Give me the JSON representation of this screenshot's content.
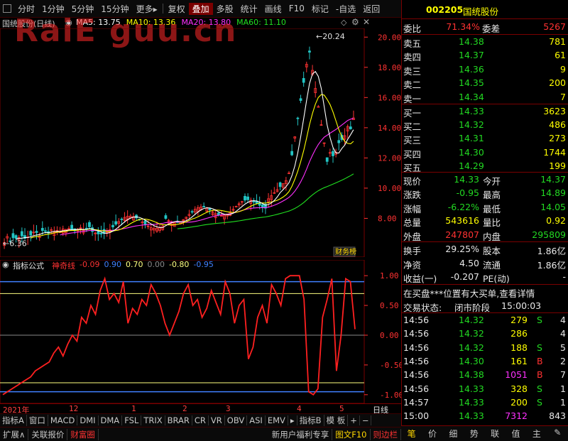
{
  "toolbar": {
    "items": [
      "分时",
      "1分钟",
      "5分钟",
      "15分钟",
      "更多",
      "复权",
      "叠加",
      "多股",
      "统计",
      "画线",
      "F10",
      "标记",
      "-自选",
      "返回"
    ],
    "more_arrow": "▸"
  },
  "watermark": "RaiE guu.cn",
  "main_chart": {
    "title": "国统股份(日线)",
    "ma_legend": [
      {
        "label": "MA5: 13.75",
        "color": "#ffffff"
      },
      {
        "label": "MA10: 13.36",
        "color": "#ffff00"
      },
      {
        "label": "MA20: 13.80",
        "color": "#ff30ff"
      },
      {
        "label": "MA60: 11.10",
        "color": "#20e020"
      }
    ],
    "price_ticks": [
      "20.00",
      "18.00",
      "16.00",
      "14.00",
      "12.00",
      "10.00",
      "8.00"
    ],
    "high_label": "20.24",
    "low_label": "6.36",
    "badge": "财务",
    "badge2": "榜"
  },
  "indicator": {
    "title": "指标公式",
    "name": "神奇线",
    "values": [
      {
        "label": "-0.09",
        "color": "#ff3232"
      },
      {
        "label": "0.90",
        "color": "#4080ff"
      },
      {
        "label": "0.70",
        "color": "#ffff80"
      },
      {
        "label": "0.00",
        "color": "#888888"
      },
      {
        "label": "-0.80",
        "color": "#ffff80"
      },
      {
        "label": "-0.95",
        "color": "#4080ff"
      }
    ],
    "ticks": [
      "1.00",
      "0.50",
      "0.00",
      "-0.50",
      "-1.00"
    ]
  },
  "time_axis": {
    "labels": [
      "2021年",
      "12",
      "1",
      "2",
      "3",
      "4",
      "5"
    ],
    "period": "日线"
  },
  "bottom_tabs": [
    "指标A",
    "窗口",
    "MACD",
    "DMI",
    "DMA",
    "FSL",
    "TRIX",
    "BRAR",
    "CR",
    "VR",
    "OBV",
    "ASI",
    "EMV",
    "▸",
    "指标B",
    "模 板",
    "+",
    "−"
  ],
  "status_bar": [
    "扩展∧",
    "关联报价",
    "财富圈",
    "新用户福利专享",
    "图文F10",
    "则边栏"
  ],
  "quote": {
    "code": "002205",
    "name": "国统股份",
    "weibi_label": "委比",
    "weibi": "71.34%",
    "weicha_label": "委差",
    "weicha": "5267",
    "asks": [
      {
        "label": "卖五",
        "price": "14.38",
        "vol": "781"
      },
      {
        "label": "卖四",
        "price": "14.37",
        "vol": "61"
      },
      {
        "label": "卖三",
        "price": "14.36",
        "vol": "9"
      },
      {
        "label": "卖二",
        "price": "14.35",
        "vol": "200"
      },
      {
        "label": "卖一",
        "price": "14.34",
        "vol": "7"
      }
    ],
    "bids": [
      {
        "label": "买一",
        "price": "14.33",
        "vol": "3623"
      },
      {
        "label": "买二",
        "price": "14.32",
        "vol": "486"
      },
      {
        "label": "买三",
        "price": "14.31",
        "vol": "273"
      },
      {
        "label": "买四",
        "price": "14.30",
        "vol": "1744"
      },
      {
        "label": "买五",
        "price": "14.29",
        "vol": "199"
      }
    ],
    "stats": [
      {
        "l1": "现价",
        "v1": "14.33",
        "c1": "green",
        "l2": "今开",
        "v2": "14.37",
        "c2": "green"
      },
      {
        "l1": "涨跌",
        "v1": "-0.95",
        "c1": "green",
        "l2": "最高",
        "v2": "14.89",
        "c2": "green"
      },
      {
        "l1": "涨幅",
        "v1": "-6.22%",
        "c1": "green",
        "l2": "最低",
        "v2": "14.05",
        "c2": "green"
      },
      {
        "l1": "总量",
        "v1": "543616",
        "c1": "yellow",
        "l2": "量比",
        "v2": "0.92",
        "c2": "yellow"
      },
      {
        "l1": "外盘",
        "v1": "247807",
        "c1": "red",
        "l2": "内盘",
        "v2": "295809",
        "c2": "green"
      }
    ],
    "stats2": [
      {
        "l1": "换手",
        "v1": "29.25%",
        "l2": "股本",
        "v2": "1.86亿"
      },
      {
        "l1": "净资",
        "v1": "4.50",
        "l2": "流通",
        "v2": "1.86亿"
      },
      {
        "l1": "收益(一)",
        "v1": "-0.207",
        "l2": "PE(动)",
        "v2": "-"
      }
    ],
    "notice": "在买盘***位置有大买单,查看详情",
    "trade_status_label": "交易状态:",
    "trade_status": "闭市阶段",
    "trade_time": "15:00:03",
    "ticks": [
      {
        "t": "14:56",
        "p": "14.32",
        "v": "279",
        "d": "S",
        "n": "4",
        "vc": "yellow",
        "dc": "green"
      },
      {
        "t": "14:56",
        "p": "14.32",
        "v": "286",
        "d": "",
        "n": "4",
        "vc": "yellow",
        "dc": "green"
      },
      {
        "t": "14:56",
        "p": "14.32",
        "v": "188",
        "d": "S",
        "n": "5",
        "vc": "yellow",
        "dc": "green"
      },
      {
        "t": "14:56",
        "p": "14.30",
        "v": "161",
        "d": "B",
        "n": "2",
        "vc": "yellow",
        "dc": "red"
      },
      {
        "t": "14:56",
        "p": "14.38",
        "v": "1051",
        "d": "B",
        "n": "7",
        "vc": "magenta",
        "dc": "red"
      },
      {
        "t": "14:56",
        "p": "14.33",
        "v": "328",
        "d": "S",
        "n": "1",
        "vc": "yellow",
        "dc": "green"
      },
      {
        "t": "14:57",
        "p": "14.33",
        "v": "200",
        "d": "S",
        "n": "1",
        "vc": "yellow",
        "dc": "green"
      },
      {
        "t": "15:00",
        "p": "14.33",
        "v": "7312",
        "d": "",
        "n": "843",
        "vc": "magenta",
        "dc": "green"
      }
    ],
    "bottom_tabs": [
      "笔",
      "价",
      "细",
      "势",
      "联",
      "值",
      "主",
      "✎"
    ]
  }
}
